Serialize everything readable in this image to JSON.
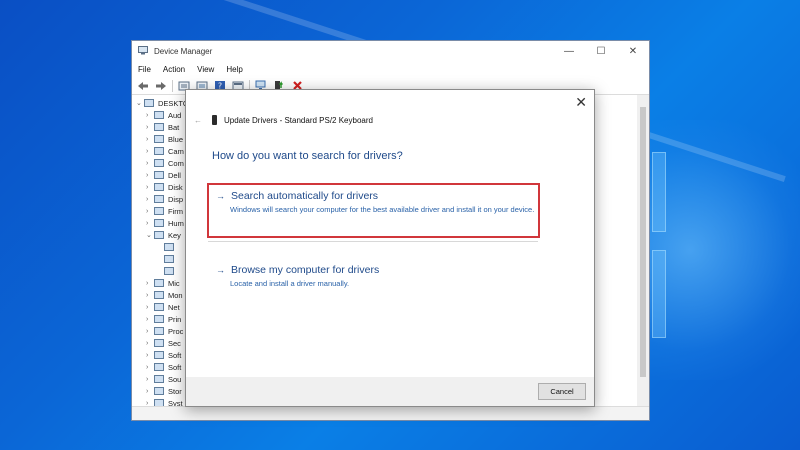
{
  "device_manager": {
    "title": "Device Manager",
    "window_controls": [
      "—",
      "☐",
      "✕"
    ],
    "menu": [
      "File",
      "Action",
      "View",
      "Help"
    ],
    "toolbar_icons": [
      "back-arrow-icon",
      "forward-arrow-icon",
      "properties-icon",
      "show-hide-icon",
      "help-icon",
      "resources-icon",
      "scan-hardware-icon",
      "update-driver-icon",
      "uninstall-icon"
    ],
    "tree": [
      {
        "label": "DESKTO",
        "expanded": true,
        "level": 0
      },
      {
        "label": "Aud",
        "level": 1
      },
      {
        "label": "Bat",
        "level": 1
      },
      {
        "label": "Blue",
        "level": 1
      },
      {
        "label": "Cam",
        "level": 1
      },
      {
        "label": "Com",
        "level": 1
      },
      {
        "label": "Dell",
        "level": 1
      },
      {
        "label": "Disk",
        "level": 1
      },
      {
        "label": "Disp",
        "level": 1
      },
      {
        "label": "Firm",
        "level": 1
      },
      {
        "label": "Hum",
        "level": 1
      },
      {
        "label": "Key",
        "expanded": true,
        "level": 1
      },
      {
        "label": "",
        "level": 2
      },
      {
        "label": "",
        "level": 2
      },
      {
        "label": "",
        "level": 2
      },
      {
        "label": "Mic",
        "level": 1
      },
      {
        "label": "Mon",
        "level": 1
      },
      {
        "label": "Net",
        "level": 1
      },
      {
        "label": "Prin",
        "level": 1
      },
      {
        "label": "Proc",
        "level": 1
      },
      {
        "label": "Sec",
        "level": 1
      },
      {
        "label": "Soft",
        "level": 1
      },
      {
        "label": "Soft",
        "level": 1
      },
      {
        "label": "Sou",
        "level": 1
      },
      {
        "label": "Stor",
        "level": 1
      },
      {
        "label": "Syst",
        "level": 1
      }
    ]
  },
  "dialog": {
    "close_glyph": "✕",
    "back_glyph": "←",
    "header": "Update Drivers - Standard PS/2 Keyboard",
    "question": "How do you want to search for drivers?",
    "options": [
      {
        "arrow": "→",
        "title": "Search automatically for drivers",
        "description": "Windows will search your computer for the best available driver and install it on your device."
      },
      {
        "arrow": "→",
        "title": "Browse my computer for drivers",
        "description": "Locate and install a driver manually."
      }
    ],
    "cancel_label": "Cancel"
  },
  "colors": {
    "link_blue": "#1f4a8a",
    "highlight_red": "#d1363b",
    "desktop_blue": "#0b66d6"
  }
}
